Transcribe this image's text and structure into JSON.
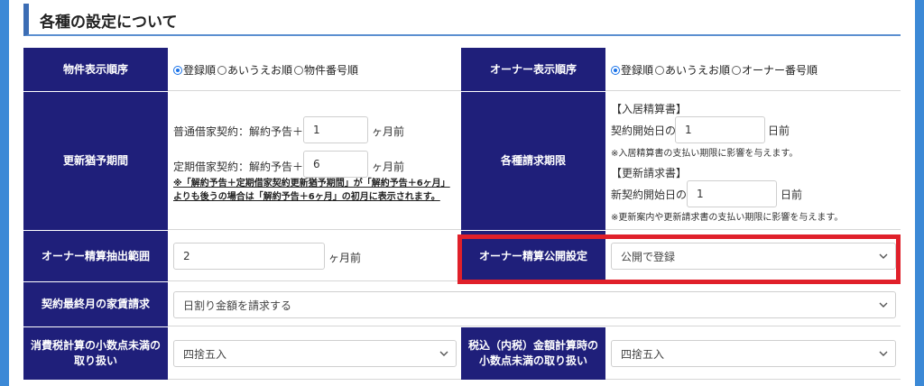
{
  "section": {
    "title": "各種の設定について"
  },
  "property_order": {
    "label": "物件表示順序",
    "options": [
      "登録順",
      "あいうえお順",
      "物件番号順"
    ],
    "selected": 0
  },
  "owner_order": {
    "label": "オーナー表示順序",
    "options": [
      "登録順",
      "あいうえお順",
      "オーナー番号順"
    ],
    "selected": 0
  },
  "renewal_grace": {
    "label": "更新猶予期間",
    "normal_label": "普通借家契約：解約予告＋",
    "normal_value": "1",
    "fixed_label": "定期借家契約：解約予告＋",
    "fixed_value": "6",
    "unit": "ヶ月前",
    "note_line1": "※「解約予告＋定期借家契約更新猶予期間」が「解約予告＋6ヶ月」",
    "note_line2": "よりも後うの場合は「解約予告＋6ヶ月」の初月に表示されます。"
  },
  "billing_deadline": {
    "label": "各種請求期限",
    "move_in_head": "【入居精算書】",
    "move_in_prefix": "契約開始日の",
    "move_in_value": "1",
    "move_in_suffix": "日前",
    "move_in_note": "※入居精算書の支払い期限に影響を与えます。",
    "renewal_head": "【更新請求書】",
    "renewal_prefix": "新契約開始日の",
    "renewal_value": "1",
    "renewal_suffix": "日前",
    "renewal_note": "※更新案内や更新請求書の支払い期限に影響を与えます。"
  },
  "owner_settlement_range": {
    "label": "オーナー精算抽出範囲",
    "value": "2",
    "unit": "ヶ月前"
  },
  "owner_settlement_publish": {
    "label": "オーナー精算公開設定",
    "selected": "公開で登録"
  },
  "final_month_rent": {
    "label": "契約最終月の家賃請求",
    "selected": "日割り金額を請求する"
  },
  "consumption_tax_rounding": {
    "label_line1": "消費税計算の小数点未満の",
    "label_line2": "取り扱い",
    "selected": "四捨五入"
  },
  "tax_inclusive_rounding": {
    "label_line1": "税込（内税）金額計算時の",
    "label_line2": "小数点未満の取り扱い",
    "selected": "四捨五入"
  },
  "colors": {
    "header_bg": "#1f1f7a",
    "page_bg": "#3c89d6",
    "highlight": "#e0202a"
  }
}
